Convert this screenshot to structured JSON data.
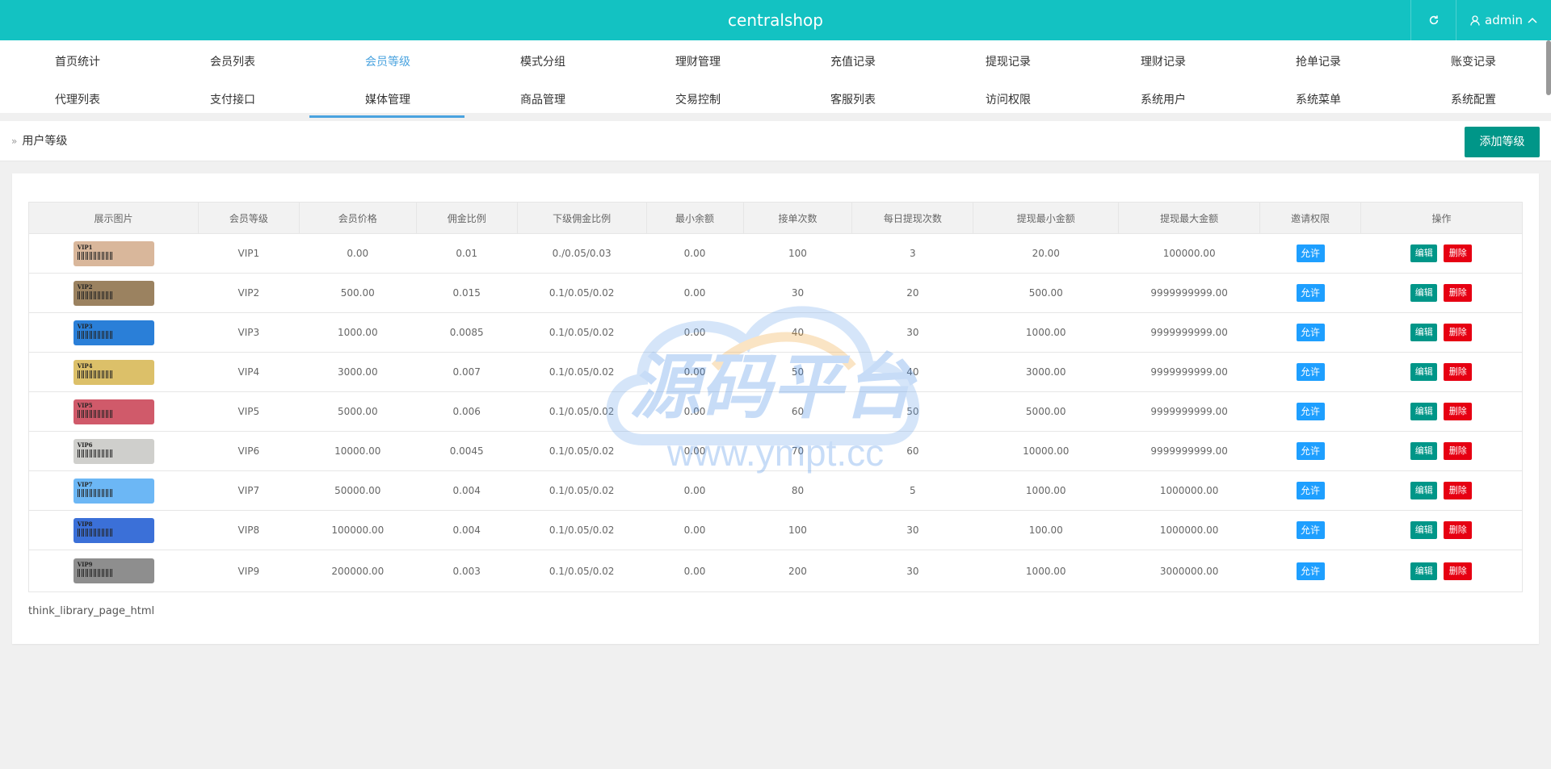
{
  "header": {
    "title": "centralshop",
    "refresh_icon": "refresh-icon",
    "user_icon": "user-icon",
    "user_label": "admin",
    "user_caret_icon": "chevron-up-icon"
  },
  "nav": {
    "row1": [
      "首页统计",
      "会员列表",
      "会员等级",
      "模式分组",
      "理财管理",
      "充值记录",
      "提现记录",
      "理财记录",
      "抢单记录",
      "账变记录"
    ],
    "row2": [
      "代理列表",
      "支付接口",
      "媒体管理",
      "商品管理",
      "交易控制",
      "客服列表",
      "访问权限",
      "系统用户",
      "系统菜单",
      "系统配置"
    ],
    "active": "会员等级"
  },
  "breadcrumb": {
    "label": "用户等级"
  },
  "toolbar": {
    "add_label": "添加等级"
  },
  "table": {
    "headers": [
      "展示图片",
      "会员等级",
      "会员价格",
      "佣金比例",
      "下级佣金比例",
      "最小余额",
      "接单次数",
      "每日提现次数",
      "提现最小金额",
      "提现最大金额",
      "邀请权限",
      "操作"
    ],
    "rows": [
      {
        "badge": "VIP1",
        "color": "#d9b79b",
        "level": "VIP1",
        "price": "0.00",
        "rate": "0.01",
        "sub_rate": "0./0.05/0.03",
        "min_balance": "0.00",
        "orders": "100",
        "daily_withdraw": "3",
        "withdraw_min": "20.00",
        "withdraw_max": "100000.00",
        "invite": "允许",
        "edit": "编辑",
        "delete": "删除"
      },
      {
        "badge": "VIP2",
        "color": "#9b8260",
        "level": "VIP2",
        "price": "500.00",
        "rate": "0.015",
        "sub_rate": "0.1/0.05/0.02",
        "min_balance": "0.00",
        "orders": "30",
        "daily_withdraw": "20",
        "withdraw_min": "500.00",
        "withdraw_max": "9999999999.00",
        "invite": "允许",
        "edit": "编辑",
        "delete": "删除"
      },
      {
        "badge": "VIP3",
        "color": "#2a7fd8",
        "level": "VIP3",
        "price": "1000.00",
        "rate": "0.0085",
        "sub_rate": "0.1/0.05/0.02",
        "min_balance": "0.00",
        "orders": "40",
        "daily_withdraw": "30",
        "withdraw_min": "1000.00",
        "withdraw_max": "9999999999.00",
        "invite": "允许",
        "edit": "编辑",
        "delete": "删除"
      },
      {
        "badge": "VIP4",
        "color": "#dcc069",
        "level": "VIP4",
        "price": "3000.00",
        "rate": "0.007",
        "sub_rate": "0.1/0.05/0.02",
        "min_balance": "0.00",
        "orders": "50",
        "daily_withdraw": "40",
        "withdraw_min": "3000.00",
        "withdraw_max": "9999999999.00",
        "invite": "允许",
        "edit": "编辑",
        "delete": "删除"
      },
      {
        "badge": "VIP5",
        "color": "#d05a6a",
        "level": "VIP5",
        "price": "5000.00",
        "rate": "0.006",
        "sub_rate": "0.1/0.05/0.02",
        "min_balance": "0.00",
        "orders": "60",
        "daily_withdraw": "50",
        "withdraw_min": "5000.00",
        "withdraw_max": "9999999999.00",
        "invite": "允许",
        "edit": "编辑",
        "delete": "删除"
      },
      {
        "badge": "VIP6",
        "color": "#cfcfcc",
        "level": "VIP6",
        "price": "10000.00",
        "rate": "0.0045",
        "sub_rate": "0.1/0.05/0.02",
        "min_balance": "0.00",
        "orders": "70",
        "daily_withdraw": "60",
        "withdraw_min": "10000.00",
        "withdraw_max": "9999999999.00",
        "invite": "允许",
        "edit": "编辑",
        "delete": "删除"
      },
      {
        "badge": "VIP7",
        "color": "#6cb7f5",
        "level": "VIP7",
        "price": "50000.00",
        "rate": "0.004",
        "sub_rate": "0.1/0.05/0.02",
        "min_balance": "0.00",
        "orders": "80",
        "daily_withdraw": "5",
        "withdraw_min": "1000.00",
        "withdraw_max": "1000000.00",
        "invite": "允许",
        "edit": "编辑",
        "delete": "删除"
      },
      {
        "badge": "VIP8",
        "color": "#3b70d8",
        "level": "VIP8",
        "price": "100000.00",
        "rate": "0.004",
        "sub_rate": "0.1/0.05/0.02",
        "min_balance": "0.00",
        "orders": "100",
        "daily_withdraw": "30",
        "withdraw_min": "100.00",
        "withdraw_max": "1000000.00",
        "invite": "允许",
        "edit": "编辑",
        "delete": "删除"
      },
      {
        "badge": "VIP9",
        "color": "#8e8e8e",
        "level": "VIP9",
        "price": "200000.00",
        "rate": "0.003",
        "sub_rate": "0.1/0.05/0.02",
        "min_balance": "0.00",
        "orders": "200",
        "daily_withdraw": "30",
        "withdraw_min": "1000.00",
        "withdraw_max": "3000000.00",
        "invite": "允许",
        "edit": "编辑",
        "delete": "删除"
      }
    ]
  },
  "pager": {
    "text": "think_library_page_html"
  },
  "watermark": {
    "title": "源码平台",
    "url": "www.ympt.cc"
  },
  "colors": {
    "header": "#13c2c2",
    "primary": "#009688",
    "active": "#4aa3df",
    "allow": "#1e9fff",
    "danger": "#e60012",
    "price": "#5fb878"
  }
}
